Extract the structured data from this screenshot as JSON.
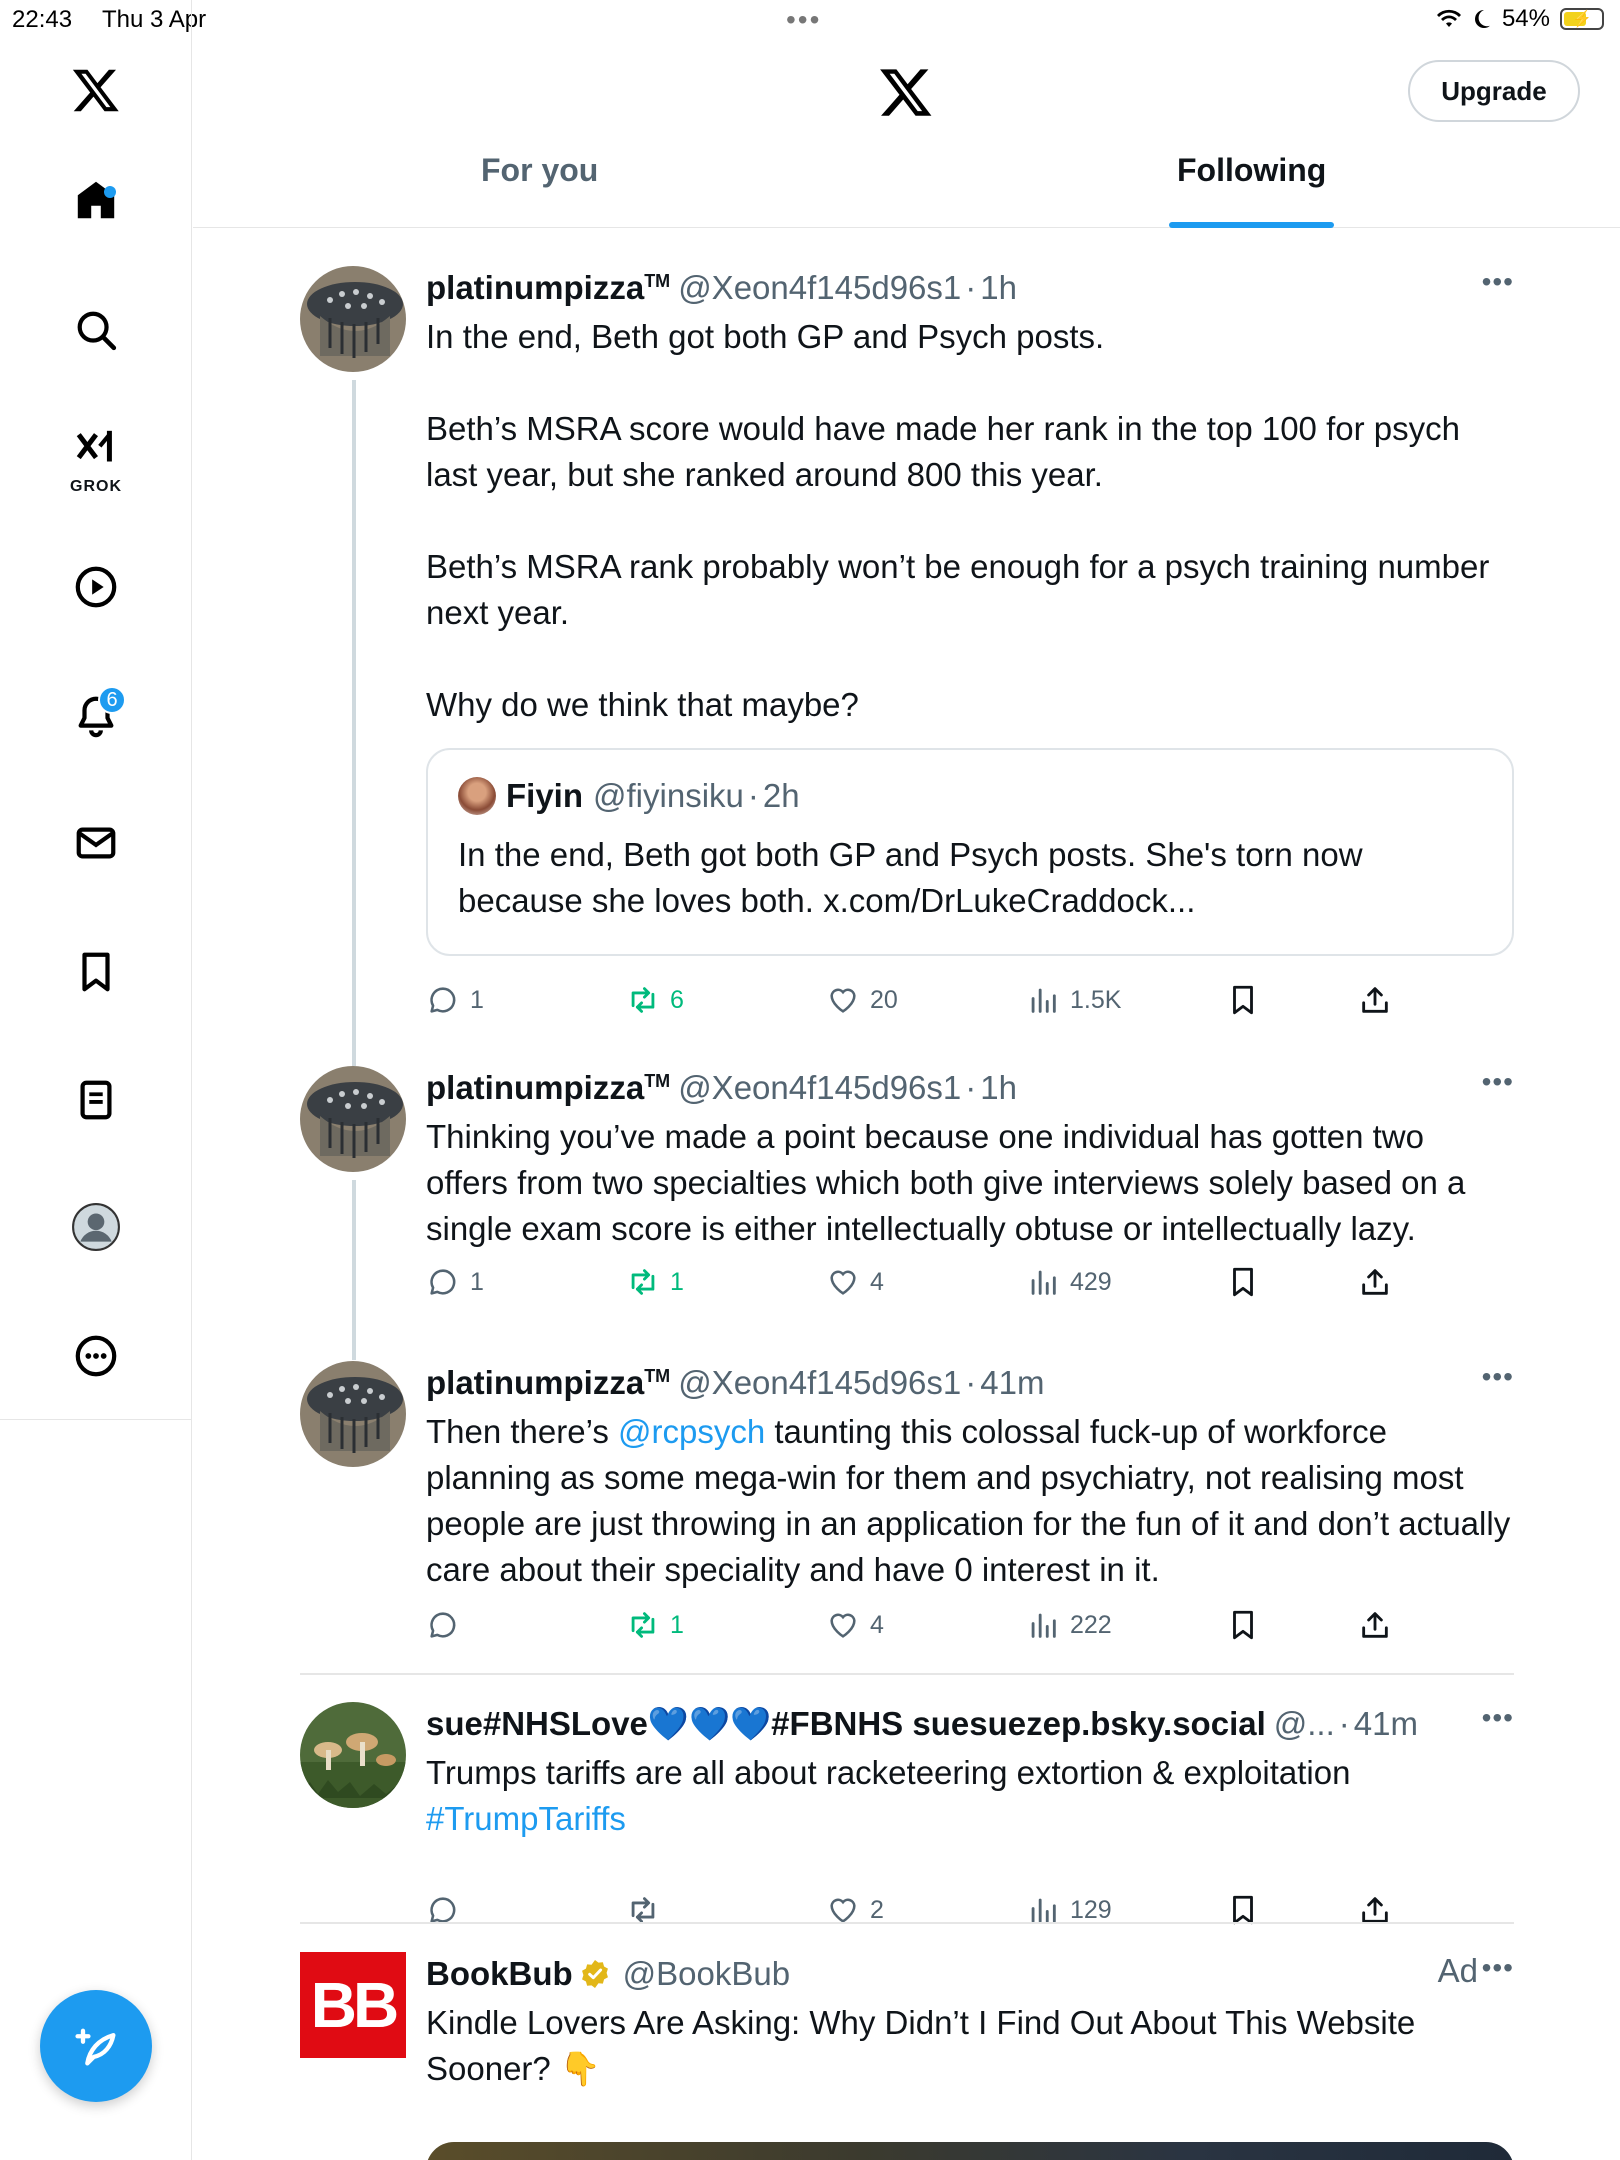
{
  "status_bar": {
    "time": "22:43",
    "date": "Thu 3 Apr",
    "battery": "54%",
    "battery_level": 0.54
  },
  "sidebar": {
    "items": [
      {
        "name": "home"
      },
      {
        "name": "explore"
      },
      {
        "name": "grok",
        "label": "GROK"
      },
      {
        "name": "videos"
      },
      {
        "name": "notifications",
        "badge": "6"
      },
      {
        "name": "messages"
      },
      {
        "name": "bookmarks"
      },
      {
        "name": "lists"
      },
      {
        "name": "profile"
      },
      {
        "name": "more"
      }
    ]
  },
  "header": {
    "upgrade_label": "Upgrade",
    "tabs": [
      {
        "label": "For you"
      },
      {
        "label": "Following",
        "active": true
      }
    ]
  },
  "posts": [
    {
      "name": "platinumpizza",
      "tm": "TM",
      "handle": "@Xeon4f145d96s1",
      "time": "1h",
      "paragraphs": [
        "In the end, Beth got both GP and Psych posts.",
        "Beth’s MSRA score would have made her rank in the top 100 for psych last year, but she ranked around 800 this year.",
        "Beth’s MSRA rank probably won’t be enough for a psych training number next year.",
        "Why do we think that maybe?"
      ],
      "quote": {
        "name": "Fiyin",
        "handle": "@fiyinsiku",
        "time": "2h",
        "text": "In the end, Beth got both GP and Psych posts. She's torn now because she loves both. x.com/DrLukeCraddock..."
      },
      "replies": "1",
      "reposts": "6",
      "likes": "20",
      "views": "1.5K"
    },
    {
      "name": "platinumpizza",
      "tm": "TM",
      "handle": "@Xeon4f145d96s1",
      "time": "1h",
      "text": "Thinking you’ve made a point because one individual has gotten two offers from two specialties which both give interviews solely based on a single exam score is either intellectually obtuse or intellectually lazy.",
      "replies": "1",
      "reposts": "1",
      "likes": "4",
      "views": "429"
    },
    {
      "name": "platinumpizza",
      "tm": "TM",
      "handle": "@Xeon4f145d96s1",
      "time": "41m",
      "text_before": "Then there’s ",
      "mention": "@rcpsych",
      "text_after": " taunting this colossal fuck-up of workforce planning as some mega-win for them and psychiatry, not realising most people are just throwing in an application for the fun of it and don’t actually care about their speciality and have 0 interest in it.",
      "replies": "",
      "reposts": "1",
      "likes": "4",
      "views": "222"
    },
    {
      "name": "sue#NHSLove💙💙💙#FBNHS suesuezep.bsky.social",
      "handle": "@...",
      "time": "41m",
      "text": "Trumps tariffs are all about racketeering extortion & exploitation",
      "hashtag": "#TrumpTariffs",
      "replies": "",
      "reposts": "",
      "likes": "2",
      "views": "129"
    },
    {
      "name": "BookBub",
      "handle": "@BookBub",
      "ad_label": "Ad",
      "logo_text": "BB",
      "text": "Kindle Lovers Are Asking: Why Didn’t I Find Out About This Website Sooner? 👇"
    }
  ],
  "colors": {
    "accent": "#1d9bf0",
    "repost": "#00ba7c",
    "muted": "#536471",
    "bookbub": "#e00b13"
  }
}
